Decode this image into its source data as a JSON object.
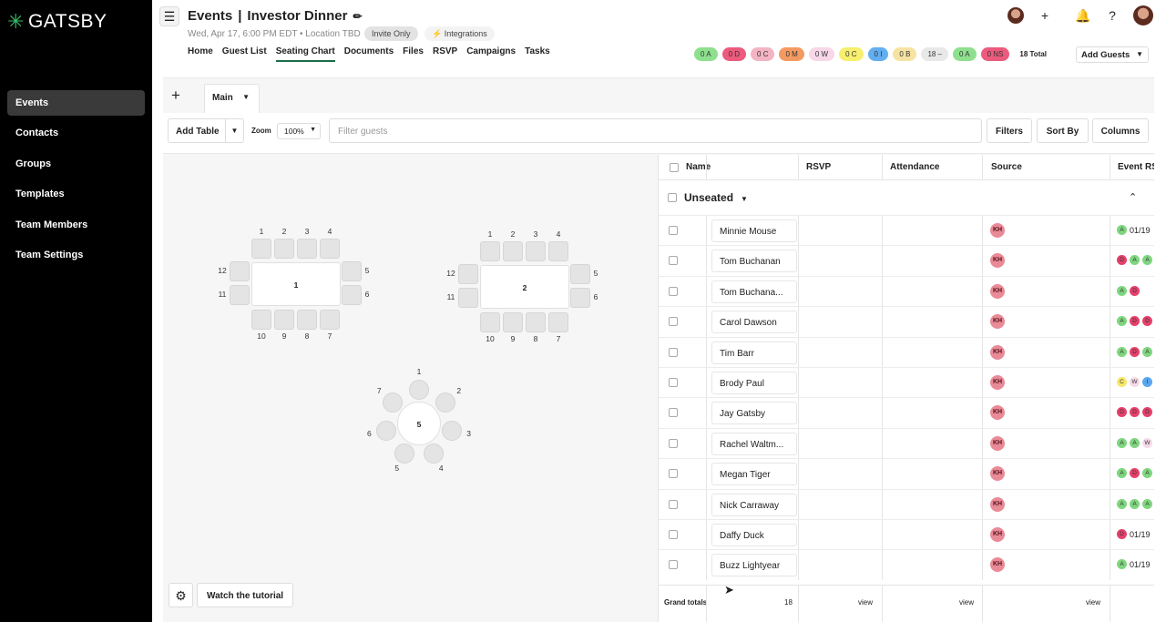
{
  "sidebar": {
    "logo": "GATSBY",
    "items": [
      {
        "label": "Events",
        "active": true
      },
      {
        "label": "Contacts"
      },
      {
        "label": "Groups"
      },
      {
        "label": "Templates"
      },
      {
        "label": "Team Members"
      },
      {
        "label": "Team Settings"
      }
    ]
  },
  "header": {
    "section": "Events",
    "separator": "|",
    "event_name": "Investor Dinner",
    "subtitle": "Wed, Apr 17, 6:00 PM EDT • Location TBD",
    "invite_badge": "Invite Only",
    "integrations": "⚡ Integrations",
    "tabs": [
      "Home",
      "Guest List",
      "Seating Chart",
      "Documents",
      "Files",
      "RSVP",
      "Campaigns",
      "Tasks"
    ],
    "active_tab": "Seating Chart"
  },
  "counts": {
    "pills": [
      {
        "label": "0 A",
        "color": "#8ee08e"
      },
      {
        "label": "0 D",
        "color": "#ec5a7e"
      },
      {
        "label": "0 C",
        "color": "#f3b4c4"
      },
      {
        "label": "0 M",
        "color": "#f39a62"
      },
      {
        "label": "0 W",
        "color": "#f7d7e8"
      },
      {
        "label": "0 C",
        "color": "#f7ef6e"
      },
      {
        "label": "0 I",
        "color": "#62aef0"
      },
      {
        "label": "0 B",
        "color": "#f6e3a2"
      },
      {
        "label": "18 –",
        "color": "#e8e8e8"
      },
      {
        "label": "0 A",
        "color": "#8ee08e"
      },
      {
        "label": "0 NS",
        "color": "#ec5a7e"
      }
    ],
    "total": "18 Total",
    "add_guests": "Add Guests"
  },
  "tabs": {
    "add": "+",
    "main": "Main"
  },
  "toolbar": {
    "add_table": "Add Table",
    "zoom_label": "Zoom",
    "zoom_value": "100%",
    "filter_placeholder": "Filter guests",
    "filters": "Filters",
    "sort_by": "Sort By",
    "columns": "Columns"
  },
  "tables": [
    {
      "label": "1",
      "seats": [
        "1",
        "2",
        "3",
        "4",
        "5",
        "6",
        "7",
        "8",
        "9",
        "10",
        "11",
        "12"
      ]
    },
    {
      "label": "2",
      "seats": [
        "1",
        "2",
        "3",
        "4",
        "5",
        "6",
        "7",
        "8",
        "9",
        "10",
        "11",
        "12"
      ]
    },
    {
      "label": "5",
      "seats": [
        "1",
        "2",
        "3",
        "4",
        "5",
        "6",
        "7"
      ]
    }
  ],
  "bottom": {
    "tutorial": "Watch the tutorial"
  },
  "grid": {
    "columns": [
      "Name",
      "RSVP",
      "Attendance",
      "Source",
      "Event RS"
    ],
    "group": "Unseated",
    "guests": [
      {
        "name": "Minnie Mouse",
        "source": "KH",
        "event": [
          "A"
        ],
        "date": "01/19"
      },
      {
        "name": "Tom Buchanan",
        "source": "KH",
        "event": [
          "D",
          "A",
          "A"
        ],
        "date": ""
      },
      {
        "name": "Tom Buchana...",
        "source": "KH",
        "event": [
          "A",
          "D"
        ],
        "date": ""
      },
      {
        "name": "Carol Dawson",
        "source": "KH",
        "event": [
          "A",
          "D",
          "D"
        ],
        "date": ""
      },
      {
        "name": "Tim Barr",
        "source": "KH",
        "event": [
          "A",
          "D",
          "A"
        ],
        "date": ""
      },
      {
        "name": "Brody Paul",
        "source": "KH",
        "event": [
          "C",
          "W",
          "I"
        ],
        "date": ""
      },
      {
        "name": "Jay Gatsby",
        "source": "KH",
        "event": [
          "D",
          "D",
          "D"
        ],
        "date": ""
      },
      {
        "name": "Rachel Waltm...",
        "source": "KH",
        "event": [
          "A",
          "A",
          "W"
        ],
        "date": ""
      },
      {
        "name": "Megan Tiger",
        "source": "KH",
        "event": [
          "A",
          "D",
          "A"
        ],
        "date": ""
      },
      {
        "name": "Nick Carraway",
        "source": "KH",
        "event": [
          "A",
          "A",
          "A"
        ],
        "date": ""
      },
      {
        "name": "Daffy Duck",
        "source": "KH",
        "event": [
          "D"
        ],
        "date": "01/19"
      },
      {
        "name": "Buzz Lightyear",
        "source": "KH",
        "event": [
          "A"
        ],
        "date": "01/19"
      }
    ],
    "totals": {
      "label": "Grand totals",
      "count": "18",
      "rsvp": "view",
      "attendance": "view",
      "source": "view"
    }
  }
}
